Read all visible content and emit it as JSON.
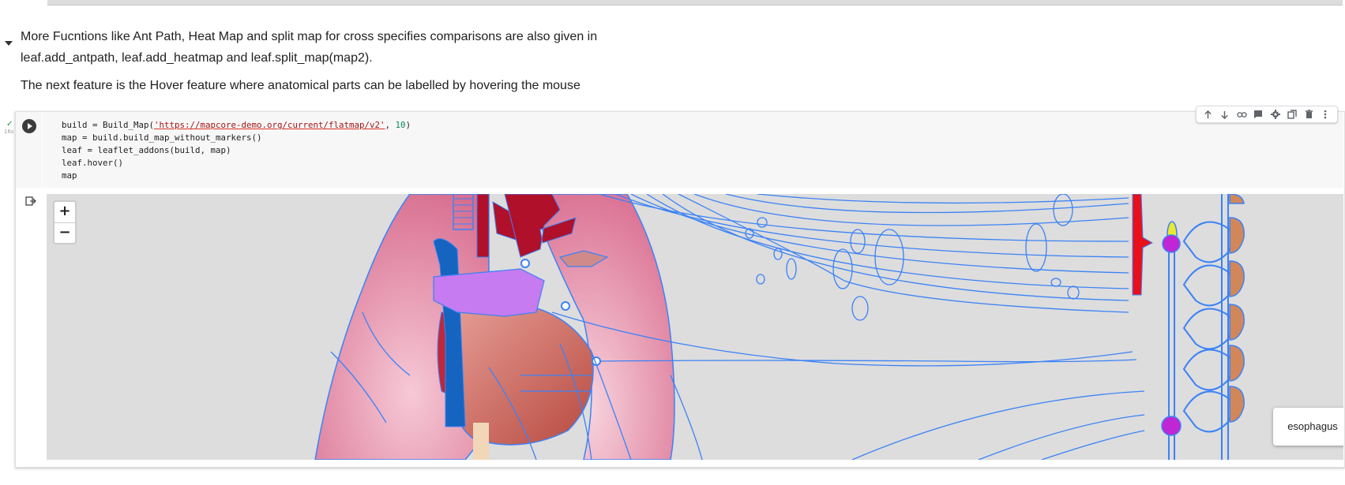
{
  "markdown": {
    "para1_line1": "More Fucntions like Ant Path, Heat Map and split map for cross specifies comparisons are also given in",
    "para1_line2": "leaf.add_antpath, leaf.add_heatmap and leaf.split_map(map2).",
    "para2": "The next feature is the Hover feature where anatomical parts can be labelled by hovering the mouse"
  },
  "cell": {
    "exec_status": "✓",
    "exec_time": "16s",
    "code": {
      "l1_a": "build = Build_Map(",
      "l1_str": "'https://mapcore-demo.org/current/flatmap/v2'",
      "l1_b": ", ",
      "l1_num": "10",
      "l1_c": ")",
      "l2": "map = build.build_map_without_markers()",
      "l3": "leaf = leaflet_addons(build, map)",
      "l4": "leaf.hover()",
      "l5": "map"
    },
    "toolbar_icons": [
      "arrow-up-icon",
      "arrow-down-icon",
      "link-icon",
      "comment-icon",
      "gear-icon",
      "mirror-cell-icon",
      "delete-icon",
      "more-vert-icon"
    ]
  },
  "map": {
    "zoom_in_label": "+",
    "zoom_out_label": "−",
    "hover_label": "esophagus",
    "colors": {
      "background": "#dddddd",
      "nerve": "#3b82f6",
      "lung": "#e07f9b",
      "artery": "#b0102a",
      "vein": "#1565c0",
      "highlight": "#c67bf0",
      "heart": "#c8564a"
    }
  }
}
